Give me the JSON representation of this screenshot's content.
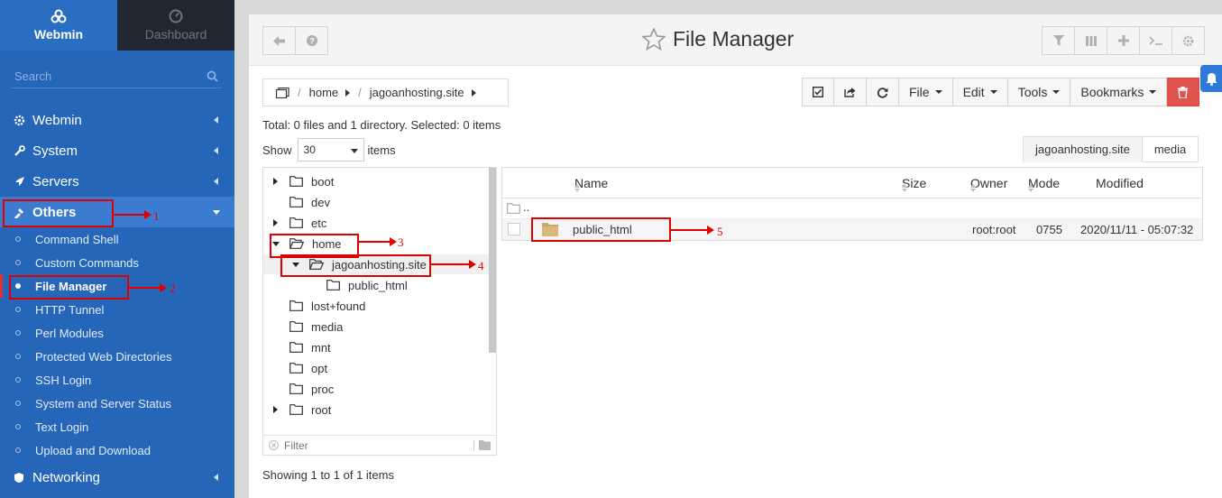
{
  "sidebar": {
    "tabs": [
      {
        "label": "Webmin",
        "icon": "webmin-logo-icon"
      },
      {
        "label": "Dashboard",
        "icon": "dashboard-gauge-icon"
      }
    ],
    "search_placeholder": "Search",
    "menu": [
      {
        "label": "Webmin",
        "icon": "gear-icon"
      },
      {
        "label": "System",
        "icon": "wrench-icon"
      },
      {
        "label": "Servers",
        "icon": "rocket-icon"
      },
      {
        "label": "Others",
        "icon": "wrench-pen-icon"
      }
    ],
    "submenu": [
      "Command Shell",
      "Custom Commands",
      "File Manager",
      "HTTP Tunnel",
      "Perl Modules",
      "Protected Web Directories",
      "SSH Login",
      "System and Server Status",
      "Text Login",
      "Upload and Download"
    ],
    "networking_label": "Networking"
  },
  "header": {
    "title": "File Manager"
  },
  "breadcrumb": {
    "items": [
      "home",
      "jagoanhosting.site"
    ]
  },
  "toolbar": {
    "file": "File",
    "edit": "Edit",
    "tools": "Tools",
    "bookmarks": "Bookmarks"
  },
  "summary": "Total: 0 files and 1 directory. Selected: 0 items",
  "show": {
    "label": "Show",
    "value": "30",
    "suffix": "items"
  },
  "tabs": [
    "jagoanhosting.site",
    "media"
  ],
  "tree": {
    "items": [
      "boot",
      "dev",
      "etc",
      "home",
      "jagoanhosting.site",
      "public_html",
      "lost+found",
      "media",
      "mnt",
      "opt",
      "proc",
      "root"
    ],
    "filter_placeholder": "Filter"
  },
  "table": {
    "headers": {
      "name": "Name",
      "size": "Size",
      "owner": "Owner",
      "mode": "Mode",
      "modified": "Modified"
    },
    "parent": "..",
    "rows": [
      {
        "name": "public_html",
        "size": "",
        "owner": "root:root",
        "mode": "0755",
        "modified": "2020/11/11 - 05:07:32"
      }
    ]
  },
  "footer": "Showing 1 to 1 of 1 items",
  "annotations": [
    "1",
    "2",
    "3",
    "4",
    "5"
  ],
  "colors": {
    "sidebar": "#2666b8",
    "annotation": "#e00000",
    "delete": "#e0544d"
  }
}
